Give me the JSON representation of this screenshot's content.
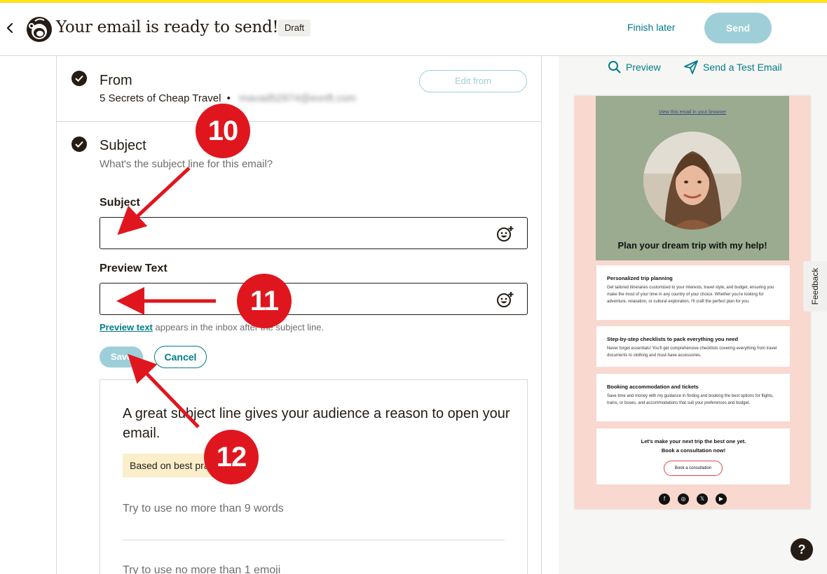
{
  "header": {
    "title": "Your email is ready to send!",
    "draft_badge": "Draft",
    "finish_later": "Finish later",
    "send": "Send"
  },
  "from_section": {
    "title": "From",
    "sender_name": "5 Secrets of Cheap Travel",
    "separator": "•",
    "sender_email": "mavad52974@evnft.com",
    "edit_button": "Edit from"
  },
  "subject_section": {
    "title": "Subject",
    "description": "What's the subject line for this email?",
    "subject_label": "Subject",
    "subject_value": "",
    "preview_label": "Preview Text",
    "preview_value": "",
    "help_link": "Preview text",
    "help_rest": " appears in the inbox after the subject line.",
    "save": "Save",
    "cancel": "Cancel"
  },
  "tips": {
    "heading": "A great subject line gives your audience a reason to open your email.",
    "badge": "Based on best practices",
    "items": [
      "Try to use no more than 9 words",
      "Try to use no more than 1 emoji"
    ]
  },
  "preview_panel": {
    "preview_link": "Preview",
    "test_email_link": "Send a Test Email",
    "view_in_browser": "View this email in your browser",
    "hero_title": "Plan your dream trip with my help!",
    "blocks": [
      {
        "title": "Personalized trip planning",
        "body": "Get tailored itineraries customized to your interests, travel style, and budget, ensuring you make the most of your time in any country of your choice. Whether you're looking for adventure, relaxation, or cultural exploration, I'll craft the perfect plan for you."
      },
      {
        "title": "Step-by-step checklists to pack everything you need",
        "body": "Never forget essentials! You'll get comprehensive checklists covering everything from travel documents to clothing and must-have accessories."
      },
      {
        "title": "Booking accommodation and tickets",
        "body": "Save time and money with my guidance in finding and booking the best options for flights, trains, or buses, and accommodations that suit your preferences and budget."
      }
    ],
    "cta_line1": "Let's make your next trip the best one yet.",
    "cta_line2": "Book a consultation now!",
    "cta_button": "Book a consultation",
    "social": [
      "f",
      "◎",
      "𝕏",
      "▶"
    ]
  },
  "feedback_tab": "Feedback",
  "help_fab": "?",
  "annotations": {
    "step_10": "10",
    "step_11": "11",
    "step_12": "12",
    "accent_color": "#e0161e"
  },
  "colors": {
    "brand_yellow": "#ffe01b",
    "teal": "#007c89",
    "disabled_teal": "#9ecfd8",
    "text_dark": "#241c15"
  }
}
